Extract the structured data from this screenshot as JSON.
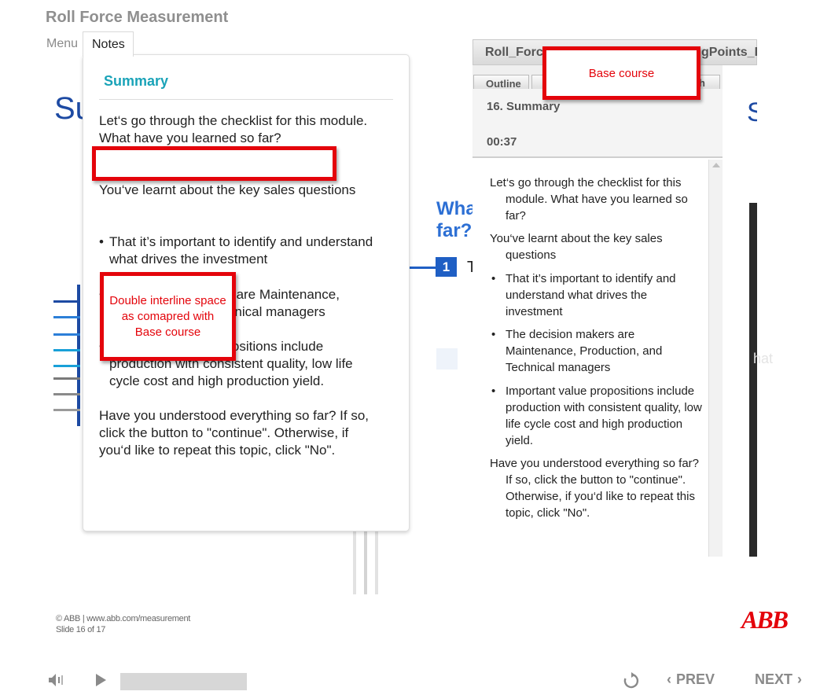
{
  "app": {
    "title": "Roll Force Measurement"
  },
  "tabs": {
    "menu": "Menu",
    "notes": "Notes"
  },
  "slide": {
    "title_fragment": "Su",
    "question_fragment": [
      "Wha",
      "far?"
    ],
    "item_number": "1",
    "item_text_fragment": "T"
  },
  "notes": {
    "heading": "Summary",
    "p1": "Let‘s go through the checklist for this module. What have you learned so far?",
    "p2": "You‘ve learnt about the key sales questions",
    "b1": "That it’s important to identify and understand what drives the investment",
    "b2": "The decision makers are Maintenance, Production, and Technical managers",
    "b3": "Important value propositions include production with consistent quality, low life cycle cost and high production yield.",
    "p3": "Have you understood everything so far? If so, click the button to \"continue\". Otherwise, if you‘d like to repeat this topic, click \"No\"."
  },
  "annotations": {
    "callout_spacing": "Double interline space as comapred with Base course",
    "callout_base": "Base course"
  },
  "base_course": {
    "header_title": "Roll_Force",
    "header_right": "gPoints_E",
    "tab_outline": "Outline",
    "tab_fragment": "h",
    "slide_title": "16. Summary",
    "time": "00:37",
    "right_letter": "S",
    "p1": "Let‘s go through the checklist for this module. What have you learned so far?",
    "p2": "You‘ve learnt about the key sales questions",
    "b1": "That it’s important to identify and understand what drives the investment",
    "b2": "The decision makers are Maintenance, Production, and Technical managers",
    "b3": "Important value propositions include production with consistent quality, low life cycle cost and high production yield.",
    "p3": "Have you understood everything so far? If so, click the button to \"continue\". Otherwise, if you‘d like to repeat this topic, click \"No\"."
  },
  "faint_right_text": "hat",
  "footer": {
    "copyright": "© ABB | www.abb.com/measurement",
    "slide_counter": "Slide 16 of 17",
    "logo": "ABB"
  },
  "controls": {
    "prev": "PREV",
    "next": "NEXT",
    "progress_fraction": 0.0
  },
  "colors": {
    "accent_blue": "#1d4aa3",
    "teal_heading": "#1aa3b8",
    "annotation_red": "#e4040b",
    "abb_red": "#e4040b"
  },
  "icons": {
    "volume": "volume-icon",
    "play": "play-icon",
    "replay": "replay-icon",
    "prev": "chevron-left-icon",
    "next": "chevron-right-icon"
  }
}
